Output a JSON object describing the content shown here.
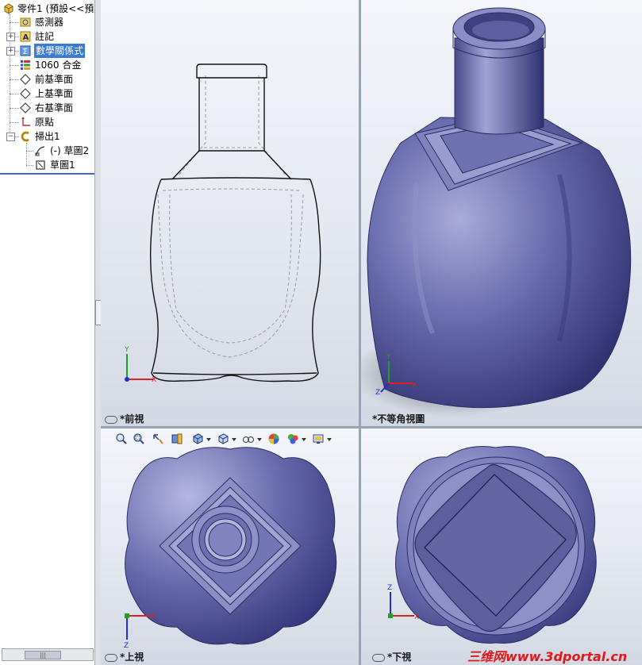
{
  "tree": {
    "root_label": "零件1 (預設<<預",
    "items": [
      {
        "label": "感測器",
        "icon": "sensor-folder-icon",
        "expandable": false
      },
      {
        "label": "註記",
        "icon": "annotation-icon",
        "expandable": true
      },
      {
        "label": "數學關係式",
        "icon": "equations-icon",
        "expandable": true,
        "selected": true
      },
      {
        "label": "1060 合金",
        "icon": "material-icon",
        "expandable": false
      },
      {
        "label": "前基準面",
        "icon": "plane-icon",
        "expandable": false
      },
      {
        "label": "上基準面",
        "icon": "plane-icon",
        "expandable": false
      },
      {
        "label": "右基準面",
        "icon": "plane-icon",
        "expandable": false
      },
      {
        "label": "原點",
        "icon": "origin-icon",
        "expandable": false
      },
      {
        "label": "掃出1",
        "icon": "sweep-feature-icon",
        "expandable": true,
        "expanded": true
      },
      {
        "label": "(-) 草圖2",
        "icon": "sketch-icon",
        "expandable": false
      },
      {
        "label": "草圖1",
        "icon": "sketch-icon",
        "expandable": false
      }
    ]
  },
  "viewports": {
    "front": {
      "label": "*前視"
    },
    "iso": {
      "label": "*不等角視圖"
    },
    "top": {
      "label": "*上視"
    },
    "bottom": {
      "label": "*下視"
    }
  },
  "triad": {
    "x": "X",
    "y": "Y",
    "z": "Z"
  },
  "toolbar": {
    "icons": [
      "zoom-to-fit-icon",
      "zoom-area-icon",
      "previous-view-icon",
      "section-view-icon",
      "view-orientation-icon",
      "display-style-icon",
      "hide-show-icon",
      "edit-appearance-icon",
      "apply-scene-icon",
      "view-settings-icon"
    ]
  },
  "watermark": "三维网www.3dportal.cn",
  "colors": {
    "body": "#5a5a9a",
    "selection": "#3a7bd5",
    "axis_x": "#e02020",
    "axis_y": "#20a020",
    "axis_z": "#2030d0"
  }
}
